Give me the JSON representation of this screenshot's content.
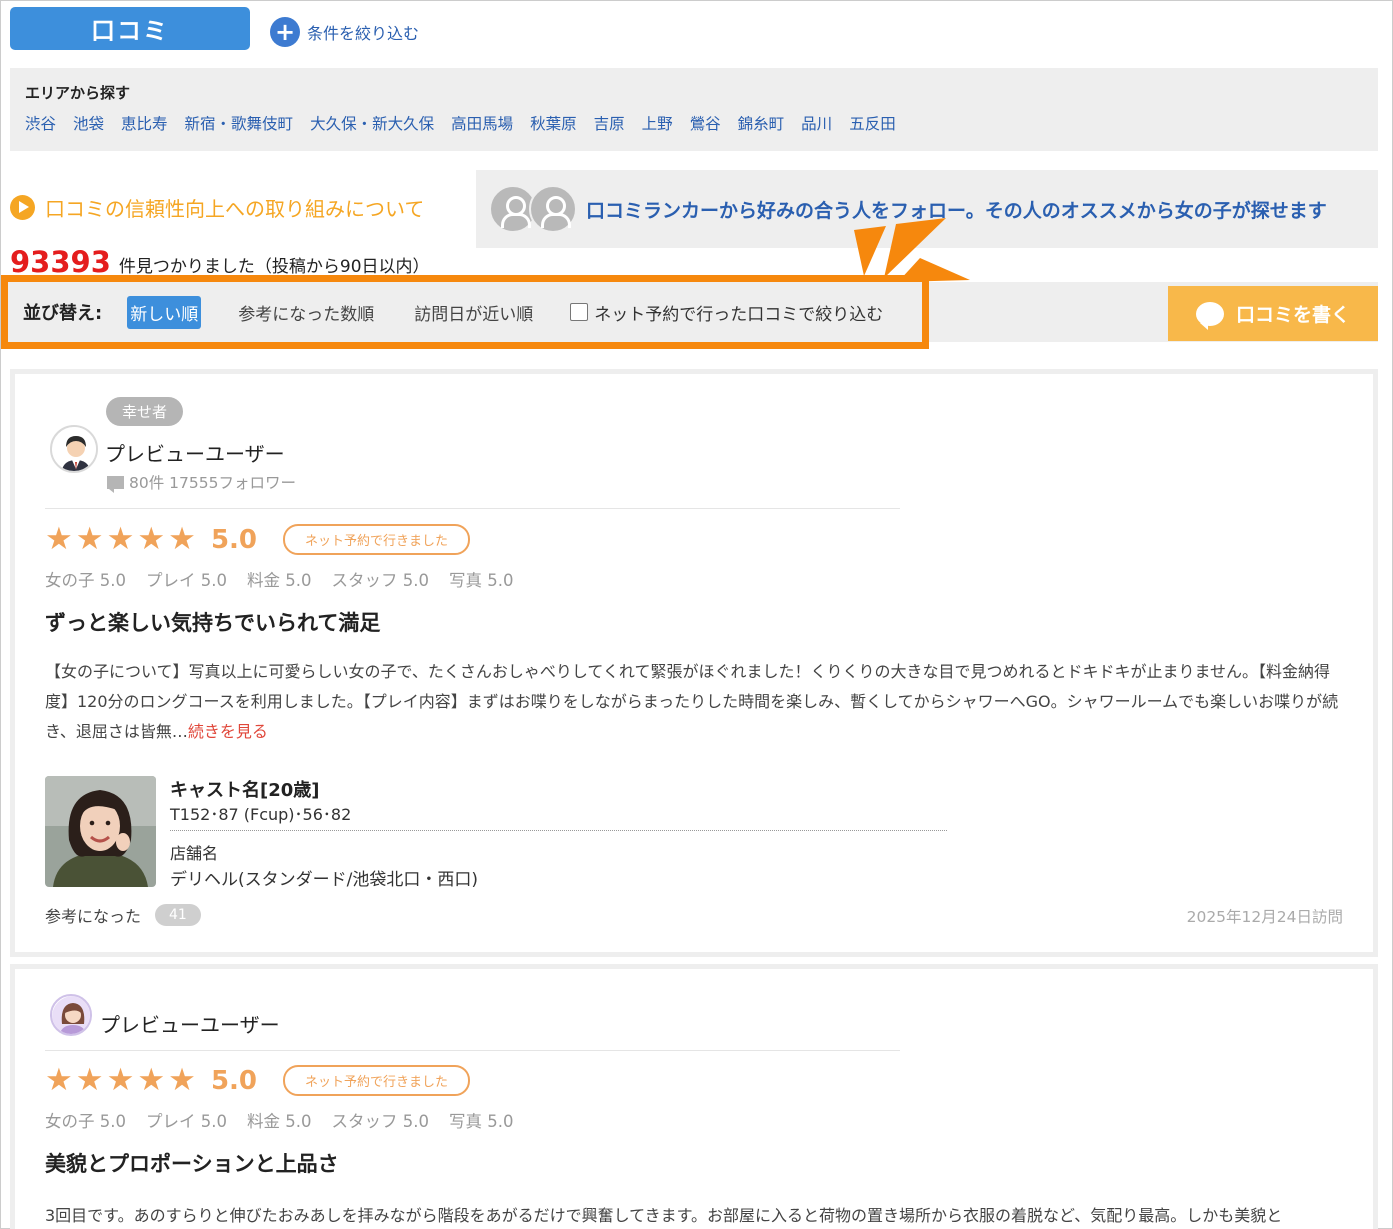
{
  "tabs": {
    "review_tab": "口コミ",
    "filter_label": "条件を絞り込む"
  },
  "area": {
    "title": "エリアから探す",
    "links": [
      "渋谷",
      "池袋",
      "恵比寿",
      "新宿・歌舞伎町",
      "大久保・新大久保",
      "高田馬場",
      "秋葉原",
      "吉原",
      "上野",
      "鶯谷",
      "錦糸町",
      "品川",
      "五反田"
    ]
  },
  "trust_link": "口コミの信頼性向上への取り組みについて",
  "ranker_text": "口コミランカーから好みの合う人をフォロー。その人のオススメから女の子が探せます",
  "results": {
    "count": "93393",
    "label": "件見つかりました（投稿から90日以内）"
  },
  "sort": {
    "title": "並び替え:",
    "options": [
      "新しい順",
      "参考になった数順",
      "訪問日が近い順"
    ],
    "active_index": 0,
    "checkbox_label": "ネット予約で行った口コミで絞り込む",
    "checkbox_checked": false
  },
  "write_button": "口コミを書く",
  "colors": {
    "accent_blue": "#3d8fdc",
    "orange": "#f6880d",
    "star": "#f0a35a",
    "link_blue": "#2a5fb0"
  },
  "reviews": [
    {
      "badge": "幸せ者",
      "user_name": "プレビューユーザー",
      "user_meta": "80件 17555フォロワー",
      "stars": "★★★★★",
      "score": "5.0",
      "net_badge": "ネット予約で行きました",
      "sub_scores": [
        "女の子 5.0",
        "プレイ 5.0",
        "料金 5.0",
        "スタッフ 5.0",
        "写真 5.0"
      ],
      "title": "ずっと楽しい気持ちでいられて満足",
      "body": "【女の子について】写真以上に可愛らしい女の子で、たくさんおしゃべりしてくれて緊張がほぐれました！くりくりの大きな目で見つめれるとドキドキが止まりません。【料金納得度】120分のロングコースを利用しました。【プレイ内容】まずはお喋りをしながらまったりした時間を楽しみ、暫くしてからシャワーへGO。シャワールームでも楽しいお喋りが続き、退屈さは皆無…",
      "more": "続きを見る",
      "cast_name": "キャスト名[20歳]",
      "cast_size": "T152･87 (Fcup)･56･82",
      "shop_label": "店舗名",
      "shop_name": "デリヘル(スタンダード/池袋北口・西口)",
      "helpful_label": "参考になった",
      "helpful_count": "41",
      "visit_date": "2025年12月24日訪問"
    },
    {
      "user_name": "プレビューユーザー",
      "stars": "★★★★★",
      "score": "5.0",
      "net_badge": "ネット予約で行きました",
      "sub_scores": [
        "女の子 5.0",
        "プレイ 5.0",
        "料金 5.0",
        "スタッフ 5.0",
        "写真 5.0"
      ],
      "title": "美貌とプロポーションと上品さ",
      "body": "3回目です。あのすらりと伸びたおみあしを拝みながら階段をあがるだけで興奮してきます。お部屋に入ると荷物の置き場所から衣服の着脱など、気配り最高。しかも美貌と"
    }
  ]
}
